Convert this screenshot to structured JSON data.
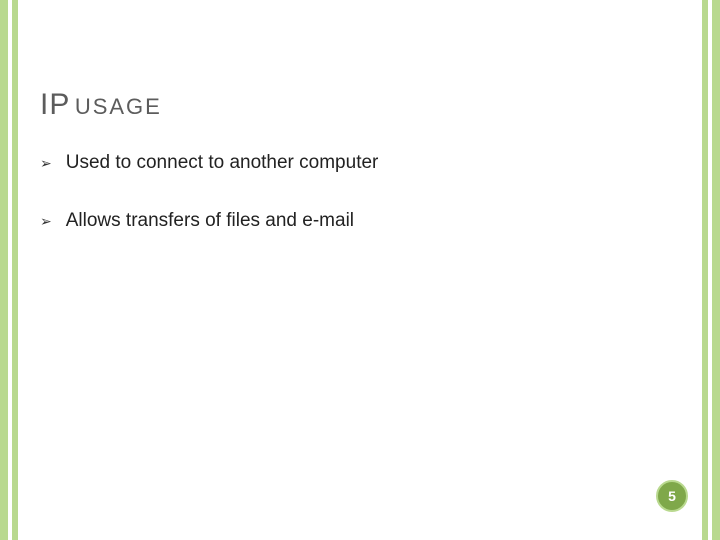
{
  "title": {
    "main": "IP",
    "sub": "USAGE"
  },
  "bullets": [
    {
      "text": "Used to connect to another computer"
    },
    {
      "text": "Allows transfers of files and e-mail"
    }
  ],
  "page_number": "5",
  "icons": {
    "bullet_glyph": "➢"
  }
}
